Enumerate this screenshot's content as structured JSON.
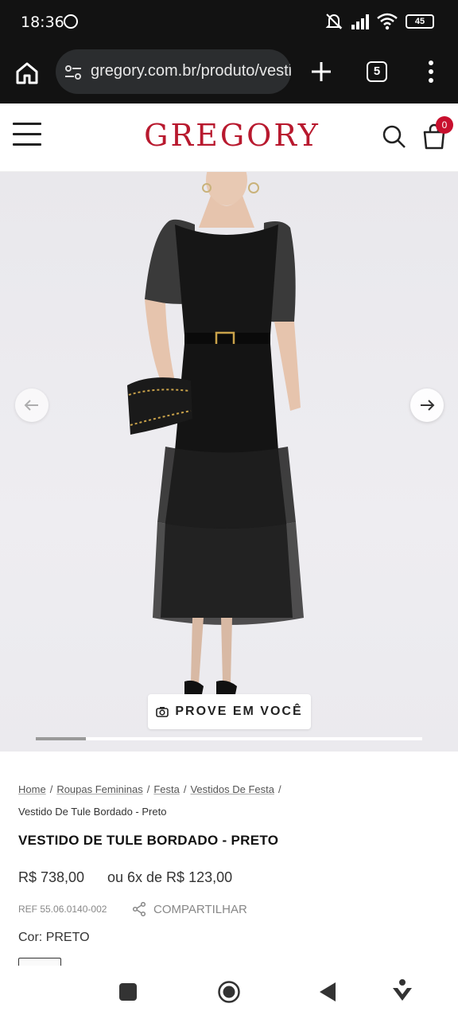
{
  "status_bar": {
    "time": "18:36",
    "battery": "45",
    "icons": [
      "whatsapp-icon",
      "mute-icon",
      "signal-icon",
      "wifi-icon",
      "battery-icon"
    ]
  },
  "browser": {
    "url": "gregory.com.br/produto/vestido-de-tule-bordado",
    "tab_count": "5",
    "icons": [
      "home-icon",
      "site-settings-icon",
      "new-tab-icon",
      "tabs-icon",
      "menu-icon"
    ]
  },
  "site_header": {
    "logo": "GREGORY",
    "cart_count": "0",
    "brand_color": "#b8192e"
  },
  "gallery": {
    "try_on_label": "PROVE EM VOCÊ",
    "carousel_progress": 0.13,
    "icons": [
      "chevron-left-icon",
      "chevron-right-icon",
      "camera-icon"
    ]
  },
  "breadcrumb": {
    "items": [
      "Home",
      "Roupas Femininas",
      "Festa",
      "Vestidos De Festa"
    ],
    "separator": "/",
    "current": "Vestido De Tule Bordado - Preto"
  },
  "product": {
    "title": "VESTIDO DE TULE BORDADO - PRETO",
    "price": "R$ 738,00",
    "installments": "ou 6x de R$ 123,00",
    "ref": "REF 55.06.0140-002",
    "share_label": "COMPARTILHAR",
    "color_label": "Cor:",
    "color_value": "PRETO"
  }
}
